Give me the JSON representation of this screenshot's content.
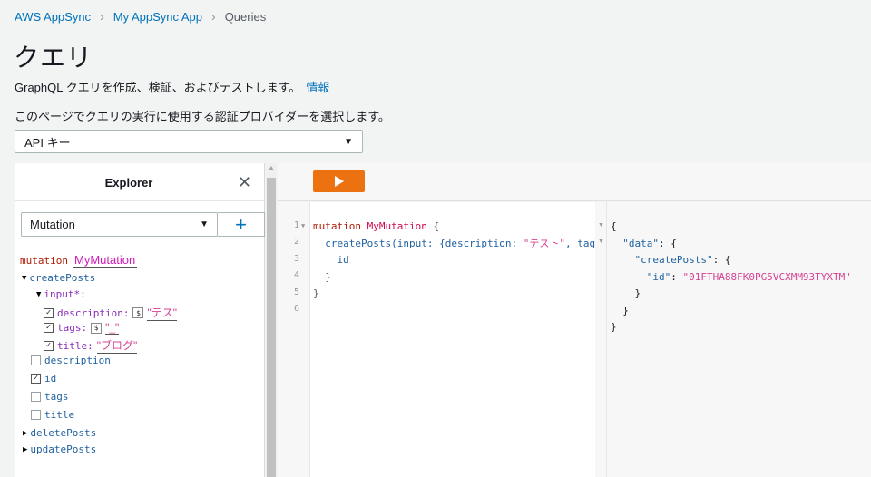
{
  "breadcrumb": {
    "items": [
      "AWS AppSync",
      "My AppSync App",
      "Queries"
    ]
  },
  "page": {
    "title": "クエリ",
    "subtitle": "GraphQL クエリを作成、検証、およびテストします。",
    "info_link": "情報",
    "auth_description": "このページでクエリの実行に使用する認証プロバイダーを選択します。",
    "auth_selected": "API キー"
  },
  "explorer": {
    "title": "Explorer",
    "operation_type": "Mutation",
    "add_label": "+",
    "mutation_keyword": "mutation",
    "operation_name": "MyMutation",
    "tree": {
      "createPosts": "createPosts",
      "input": "input*:",
      "description_label": "description:",
      "description_value": "\"テス\"",
      "tags_label": "tags:",
      "tags_value": "\"_\"",
      "title_label": "title:",
      "title_value": "\"ブログ\"",
      "fields": [
        "description",
        "id",
        "tags",
        "title"
      ],
      "deletePosts": "deletePosts",
      "updatePosts": "updatePosts"
    }
  },
  "editor": {
    "line_numbers": [
      "1",
      "2",
      "3",
      "4",
      "5",
      "6"
    ],
    "lines": [
      {
        "kw": "mutation ",
        "def": "MyMutation",
        "rest": " {"
      },
      {
        "field": "  createPosts",
        "rest": "(input: {description: ",
        "str": "\"テスト\"",
        "tail": ", tag"
      },
      {
        "field": "    id"
      },
      {
        "rest": "  }"
      },
      {
        "rest": "}"
      },
      {
        "rest": ""
      }
    ]
  },
  "result": {
    "lines": [
      {
        "text": "{"
      },
      {
        "key": "  \"data\"",
        "rest": ": {"
      },
      {
        "key": "    \"createPosts\"",
        "rest": ": {"
      },
      {
        "key": "      \"id\"",
        "rest": ": ",
        "str": "\"01FTHA88FK0PG5VCXMM93TYXTM\""
      },
      {
        "text": "    }"
      },
      {
        "text": "  }"
      },
      {
        "text": "}"
      }
    ]
  },
  "colors": {
    "accent": "#ec7211",
    "link": "#0073bb"
  }
}
